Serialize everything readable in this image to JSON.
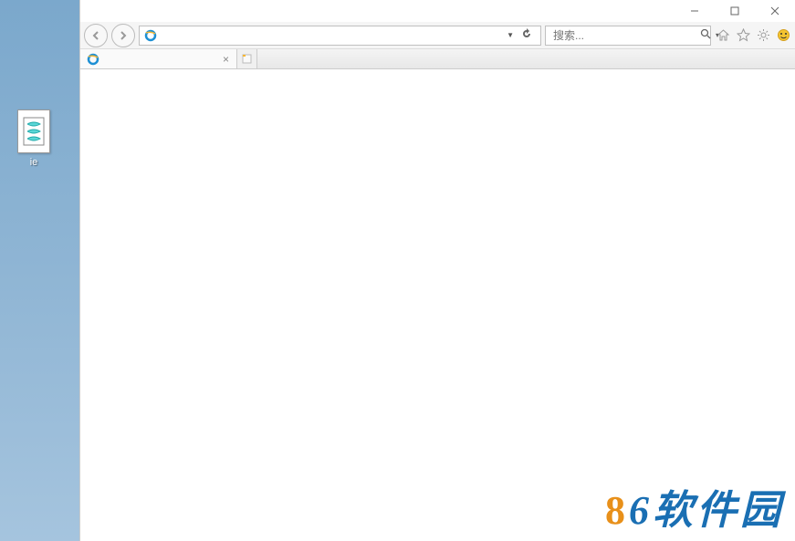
{
  "desktop": {
    "icon_label": "ie"
  },
  "window_controls": {
    "minimize": "—",
    "maximize": "☐",
    "close": "✕"
  },
  "nav": {
    "address_value": "",
    "refresh_symbol": "↻",
    "dropdown_symbol": "▼"
  },
  "search": {
    "placeholder": "搜索...",
    "value": "",
    "icon_symbol": "🔍",
    "dropdown_symbol": "▾"
  },
  "toolbar": {
    "home_icon": "⌂",
    "favorites_icon": "☆",
    "gear_icon": "⚙",
    "smiley_icon": "☺"
  },
  "tabs": [
    {
      "title": "",
      "favicon": "e"
    }
  ],
  "newtab_symbol": "📄",
  "watermark": {
    "text1": "8",
    "text2": "6",
    "text3": "软件园"
  }
}
